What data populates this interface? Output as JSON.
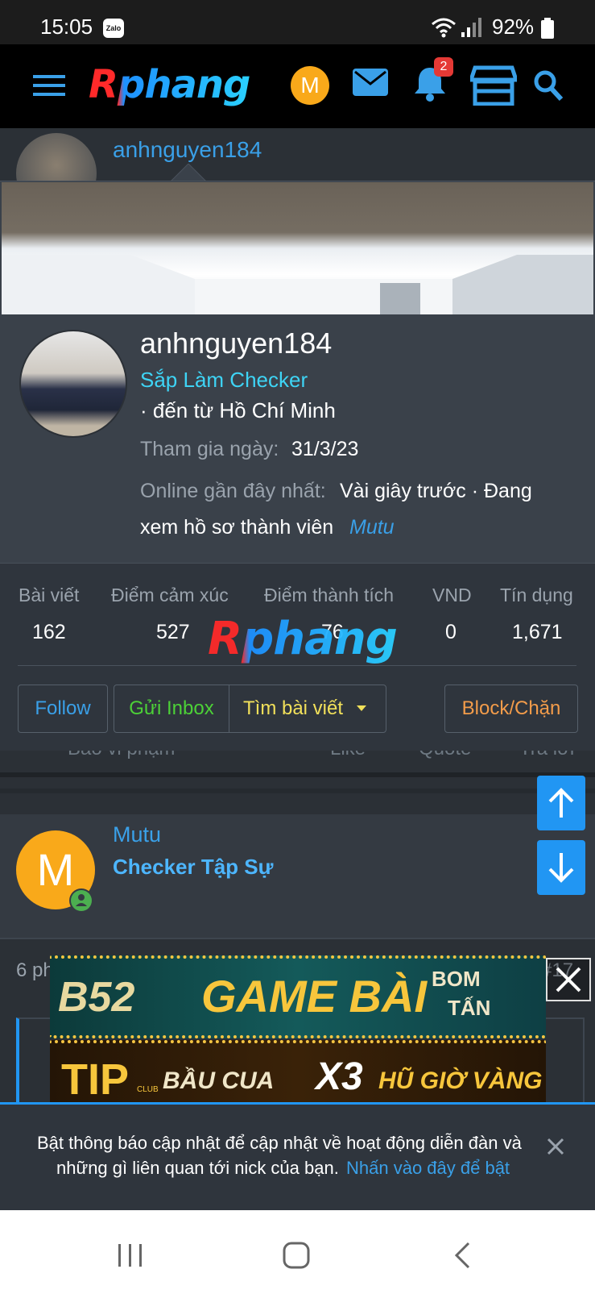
{
  "status_bar": {
    "time": "15:05",
    "zalo_badge": "Zalo",
    "battery": "92%"
  },
  "header": {
    "logo": "Rphang",
    "avatar_letter": "M",
    "notification_count": "2"
  },
  "post_author": {
    "username": "anhnguyen184",
    "title": "Sắp Làm Checker"
  },
  "profile_card": {
    "username": "anhnguyen184",
    "title": "Sắp Làm Checker",
    "location": "· đến từ Hồ Chí Minh",
    "joined_label": "Tham gia ngày:",
    "joined_value": "31/3/23",
    "online_label": "Online gần đây nhất:",
    "online_value": "Vài giây trước · Đang",
    "online_value_2": "xem hồ sơ thành viên",
    "online_link": "Mutu",
    "stats": [
      {
        "label": "Bài viết",
        "value": "162"
      },
      {
        "label": "Điểm cảm xúc",
        "value": "527"
      },
      {
        "label": "Điểm thành tích",
        "value": "76"
      },
      {
        "label": "VND",
        "value": "0"
      },
      {
        "label": "Tín dụng",
        "value": "1,671"
      }
    ],
    "watermark": "Rphang",
    "buttons": {
      "follow": "Follow",
      "inbox": "Gửi Inbox",
      "find_posts": "Tìm bài viết",
      "block": "Block/Chặn"
    }
  },
  "post_actions": {
    "report": "Báo vi phạm",
    "like": "Like",
    "quote": "Quote",
    "reply": "Trả lời"
  },
  "reply_post": {
    "username": "Mutu",
    "avatar_letter": "M",
    "title": "Checker Tập Sự",
    "time_prefix": "6 ph",
    "post_number": "#17"
  },
  "ads": {
    "banner1_brand": "B52",
    "banner1_text": "GAME BÀI",
    "banner1_side_1": "BOM",
    "banner1_side_2": "TẤN",
    "banner2_brand": "TIP",
    "banner2_brand_sub": "CLUB",
    "banner2_text_1": "BẦU CUA",
    "banner2_text_2": "X3",
    "banner2_text_3": "HŨ GIỜ VÀNG"
  },
  "notification": {
    "text_1": "Bật thông báo cập nhật để cập nhật về hoạt động diễn đàn và",
    "text_2": "những gì liên quan tới nick của bạn.",
    "link": "Nhấn vào đây để bật"
  },
  "colors": {
    "accent": "#2196f3",
    "link": "#3aa0e8",
    "online": "#4caf50",
    "avatar": "#f9a91a",
    "inbox": "#4cd137",
    "find": "#f1e05a",
    "block": "#f39c4a"
  }
}
